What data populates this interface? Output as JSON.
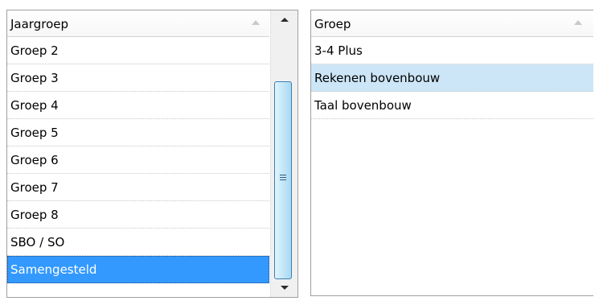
{
  "left_grid": {
    "column_header": "Jaargroep",
    "rows": [
      "Groep 2",
      "Groep 3",
      "Groep 4",
      "Groep 5",
      "Groep 6",
      "Groep 7",
      "Groep 8",
      "SBO / SO",
      "Samengesteld"
    ],
    "selected_row": "Samengesteld",
    "sort_icon": "sort-ascending-icon"
  },
  "right_grid": {
    "column_header": "Groep",
    "rows": [
      "3-4 Plus",
      "Rekenen bovenbouw",
      "Taal bovenbouw"
    ],
    "selected_row": "Rekenen bovenbouw",
    "sort_icon": "sort-ascending-icon"
  },
  "colors": {
    "selection_active": "#3399ff",
    "selection_inactive": "#cde6f7",
    "border": "#a0a0a0"
  }
}
